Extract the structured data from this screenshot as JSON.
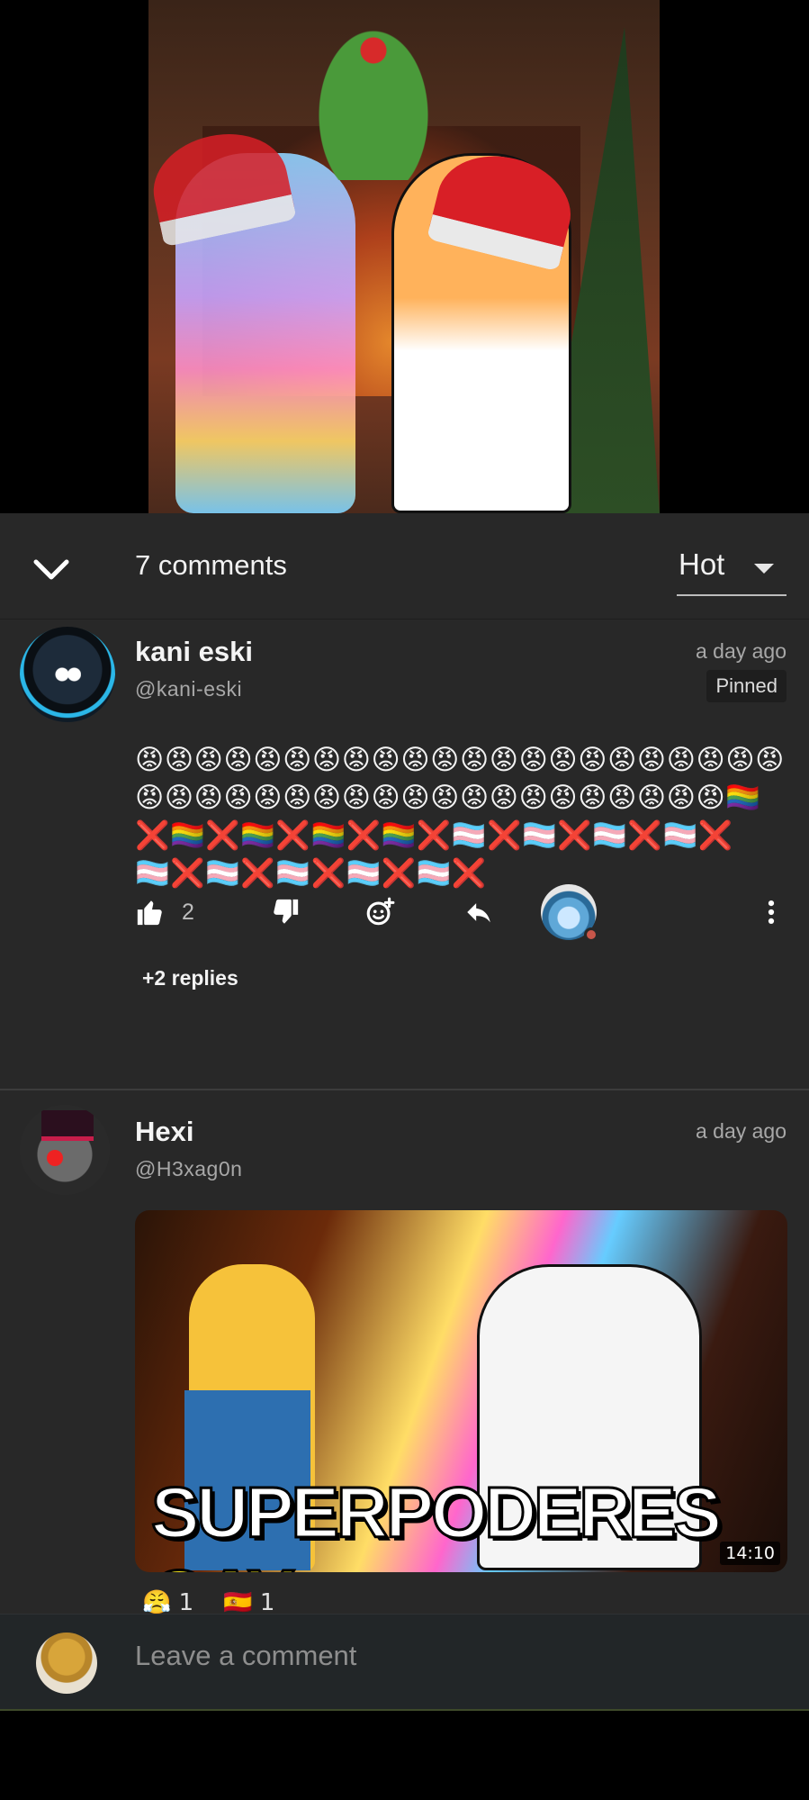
{
  "header": {
    "comment_count": "7 comments",
    "sort_label": "Hot"
  },
  "comments": [
    {
      "name": "kani eski",
      "handle": "@kani-eski",
      "time": "a day ago",
      "pinned": "Pinned",
      "text": "😡😡😡😡😡😡😡😡😡😡😡😡😡😡😡😡😡😡😡😡😡😡😡😡😡😡😡😡😡😡😡😡😡😡😡😡😡😡😡😡😡😡🏳️‍🌈❌🏳️‍🌈❌🏳️‍🌈❌🏳️‍🌈❌🏳️‍🌈❌🏳️‍⚧️❌🏳️‍⚧️❌🏳️‍⚧️❌🏳️‍⚧️❌🏳️‍⚧️❌🏳️‍⚧️❌🏳️‍⚧️❌🏳️‍⚧️❌🏳️‍⚧️❌",
      "likes": "2",
      "replies": "+2 replies"
    },
    {
      "name": "Hexi",
      "handle": "@H3xag0n",
      "time": "a day ago",
      "thumbnail_caption": "SUPERPODERES",
      "thumbnail_caption_accent": "GAY",
      "duration": "14:10"
    }
  ],
  "composer": {
    "placeholder": "Leave a comment"
  },
  "colors": {
    "sheet_bg": "#282828",
    "text_primary": "#f2f2f2",
    "text_secondary": "#a8a8a8",
    "caption_accent": "#f7e71a"
  },
  "icons": [
    "chevron-down-icon",
    "caret-down-icon",
    "thumb-up-icon",
    "thumb-down-icon",
    "add-reaction-icon",
    "reply-icon",
    "more-vert-icon"
  ]
}
